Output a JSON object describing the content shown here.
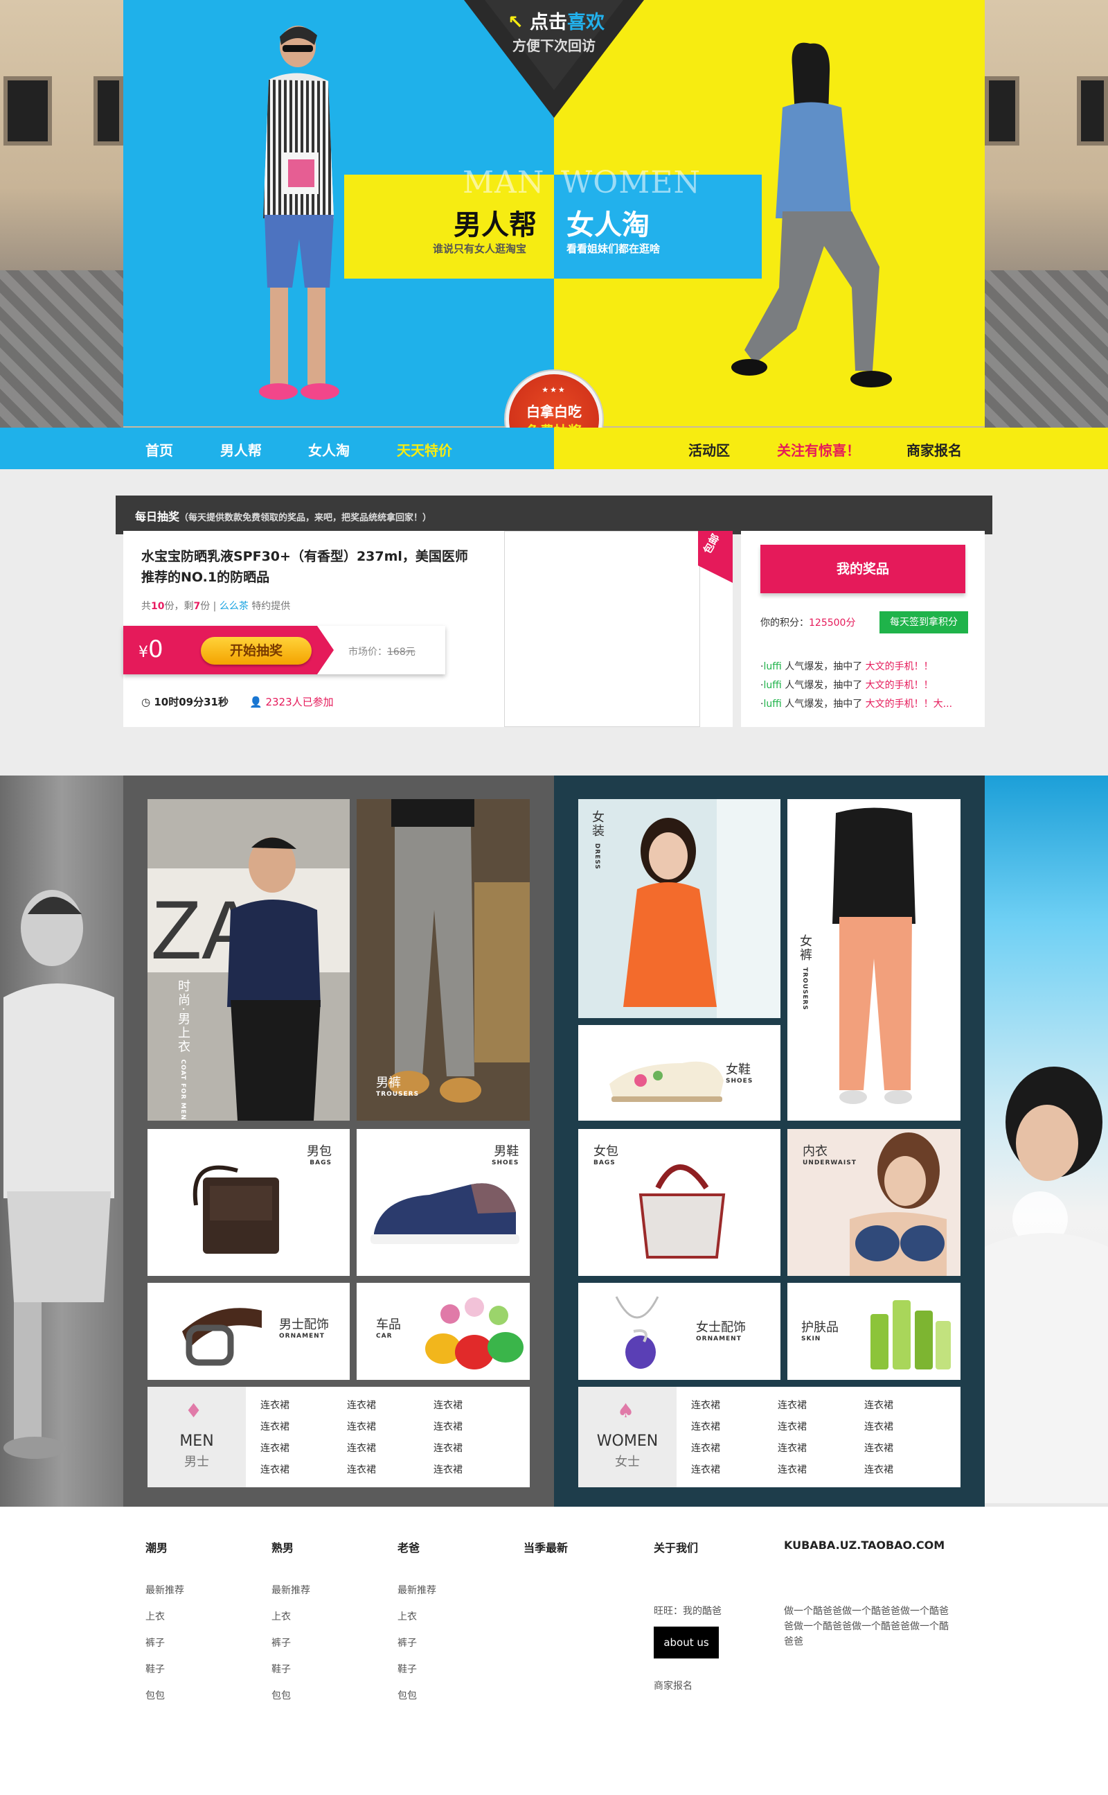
{
  "banner": {
    "favorite_prefix": "点击",
    "favorite_highlight": "喜欢",
    "favorite_sub": "方便下次回访",
    "man_en": "MAN",
    "women_en": "WOMEN",
    "man_title": "男人帮",
    "women_title": "女人淘",
    "man_sub": "谁说只有女人逛淘宝",
    "women_sub": "看看姐妹们都在逛啥",
    "badge_line1": "白拿白吃",
    "badge_line2": "免费抽奖",
    "badge_stars": "★★★"
  },
  "nav": {
    "items": [
      {
        "label": "首页",
        "color": "#ffffff"
      },
      {
        "label": "男人帮",
        "color": "#ffffff"
      },
      {
        "label": "女人淘",
        "color": "#ffffff"
      },
      {
        "label": "天天特价",
        "color": "#f7ec11"
      },
      {
        "label": "活动区",
        "color": "#222222"
      },
      {
        "label": "关注有惊喜！",
        "color": "#e51a5a"
      },
      {
        "label": "商家报名",
        "color": "#222222"
      }
    ]
  },
  "lottery": {
    "title": "每日抽奖",
    "subtitle": "（每天提供数款免费领取的奖品，来吧，把奖品统统拿回家！）",
    "product_name": "水宝宝防晒乳液SPF30+（有香型）237ml，美国医师推荐的NO.1的防晒品",
    "count_prefix": "共",
    "total": "10",
    "count_mid": "份，剩",
    "remaining": "7",
    "count_suffix": "份 |",
    "sponsor": "么么茶",
    "sponsor_suffix": "特约提供",
    "currency": "¥",
    "price": "0",
    "start_button": "开始抽奖",
    "market_label": "市场价：",
    "market_price": "168元",
    "time_left": "10时09分31秒",
    "participants": "2323人已参加",
    "free_shipping": "包邮",
    "my_prize": "我的奖品",
    "points_label": "你的积分：",
    "points_value": "125500分",
    "sign_button": "每天签到拿积分",
    "winners": [
      {
        "user": "luffi",
        "text": " 人气爆发，抽中了 ",
        "prize": "大文的手机！！"
      },
      {
        "user": "luffi",
        "text": " 人气爆发，抽中了 ",
        "prize": "大文的手机！！"
      },
      {
        "user": "luffi",
        "text": " 人气爆发，抽中了 ",
        "prize": "大文的手机！！大..."
      }
    ]
  },
  "men": {
    "tiles": {
      "coat": {
        "zh": "时尚·男上衣",
        "en": "COAT FOR MEN"
      },
      "trousers": {
        "zh": "男裤",
        "en": "TROUSERS"
      },
      "bags": {
        "zh": "男包",
        "en": "BAGS"
      },
      "shoes": {
        "zh": "男鞋",
        "en": "SHOES"
      },
      "ornament": {
        "zh": "男士配饰",
        "en": "ORNAMENT"
      },
      "car": {
        "zh": "车品",
        "en": "CAR"
      }
    },
    "links_en": "MEN",
    "links_zh": "男士",
    "links": [
      "连衣裙",
      "连衣裙",
      "连衣裙",
      "连衣裙",
      "连衣裙",
      "连衣裙",
      "连衣裙",
      "连衣裙",
      "连衣裙",
      "连衣裙",
      "连衣裙",
      "连衣裙"
    ]
  },
  "women": {
    "tiles": {
      "dress": {
        "zh": "女装",
        "en": "DRESS"
      },
      "trousers": {
        "zh": "女裤",
        "en": "TROUSERS"
      },
      "shoes": {
        "zh": "女鞋",
        "en": "SHOES"
      },
      "bags": {
        "zh": "女包",
        "en": "BAGS"
      },
      "underwear": {
        "zh": "内衣",
        "en": "UNDERWAIST"
      },
      "ornament": {
        "zh": "女士配饰",
        "en": "ORNAMENT"
      },
      "skin": {
        "zh": "护肤品",
        "en": "SKIN"
      }
    },
    "links_en": "WOMEN",
    "links_zh": "女士",
    "links": [
      "连衣裙",
      "连衣裙",
      "连衣裙",
      "连衣裙",
      "连衣裙",
      "连衣裙",
      "连衣裙",
      "连衣裙",
      "连衣裙",
      "连衣裙",
      "连衣裙",
      "连衣裙"
    ]
  },
  "footer": {
    "cols": [
      {
        "title": "潮男",
        "links": [
          "最新推荐",
          "上衣",
          "裤子",
          "鞋子",
          "包包"
        ]
      },
      {
        "title": "熟男",
        "links": [
          "最新推荐",
          "上衣",
          "裤子",
          "鞋子",
          "包包"
        ]
      },
      {
        "title": "老爸",
        "links": [
          "最新推荐",
          "上衣",
          "裤子",
          "鞋子",
          "包包"
        ]
      }
    ],
    "season_title": "当季最新",
    "about_title": "关于我们",
    "wangwang": "旺旺：我的酷爸",
    "about_button": "about us",
    "merchant": "商家报名",
    "shop_url": "KUBABA.UZ.TAOBAO.COM",
    "shop_desc": "做一个酷爸爸做一个酷爸爸做一个酷爸爸做一个酷爸爸做一个酷爸爸做一个酷爸爸"
  }
}
